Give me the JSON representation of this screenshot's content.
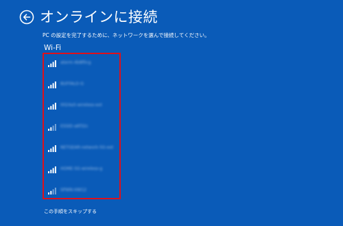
{
  "header": {
    "title": "オンラインに接続",
    "back_icon": "back-arrow-circle-icon"
  },
  "instructions": "PC の設定を完了するために、ネットワークを選んで接続してください。",
  "wifi": {
    "heading": "Wi-Fi",
    "networks": [
      {
        "ssid": "aterm-4b8f0cg",
        "signal_icon": "wifi-signal-full-icon"
      },
      {
        "ssid": "BUFFALO-G",
        "signal_icon": "wifi-signal-full-icon"
      },
      {
        "ssid": "0024a5-wireless-ext",
        "signal_icon": "wifi-signal-full-icon"
      },
      {
        "ssid": "ESSID-a6f32c",
        "signal_icon": "wifi-signal-low-icon"
      },
      {
        "ssid": "NETGEAR-network-5G-ext",
        "signal_icon": "wifi-signal-full-icon"
      },
      {
        "ssid": "HOME-5G-wireless-g",
        "signal_icon": "wifi-signal-full-icon"
      },
      {
        "ssid": "SPWN-HW12",
        "signal_icon": "wifi-signal-low-icon"
      }
    ]
  },
  "skip_link": "この手順をスキップする",
  "colors": {
    "background": "#0a5bb8",
    "highlight_border": "#e0101a",
    "text": "#ffffff"
  }
}
